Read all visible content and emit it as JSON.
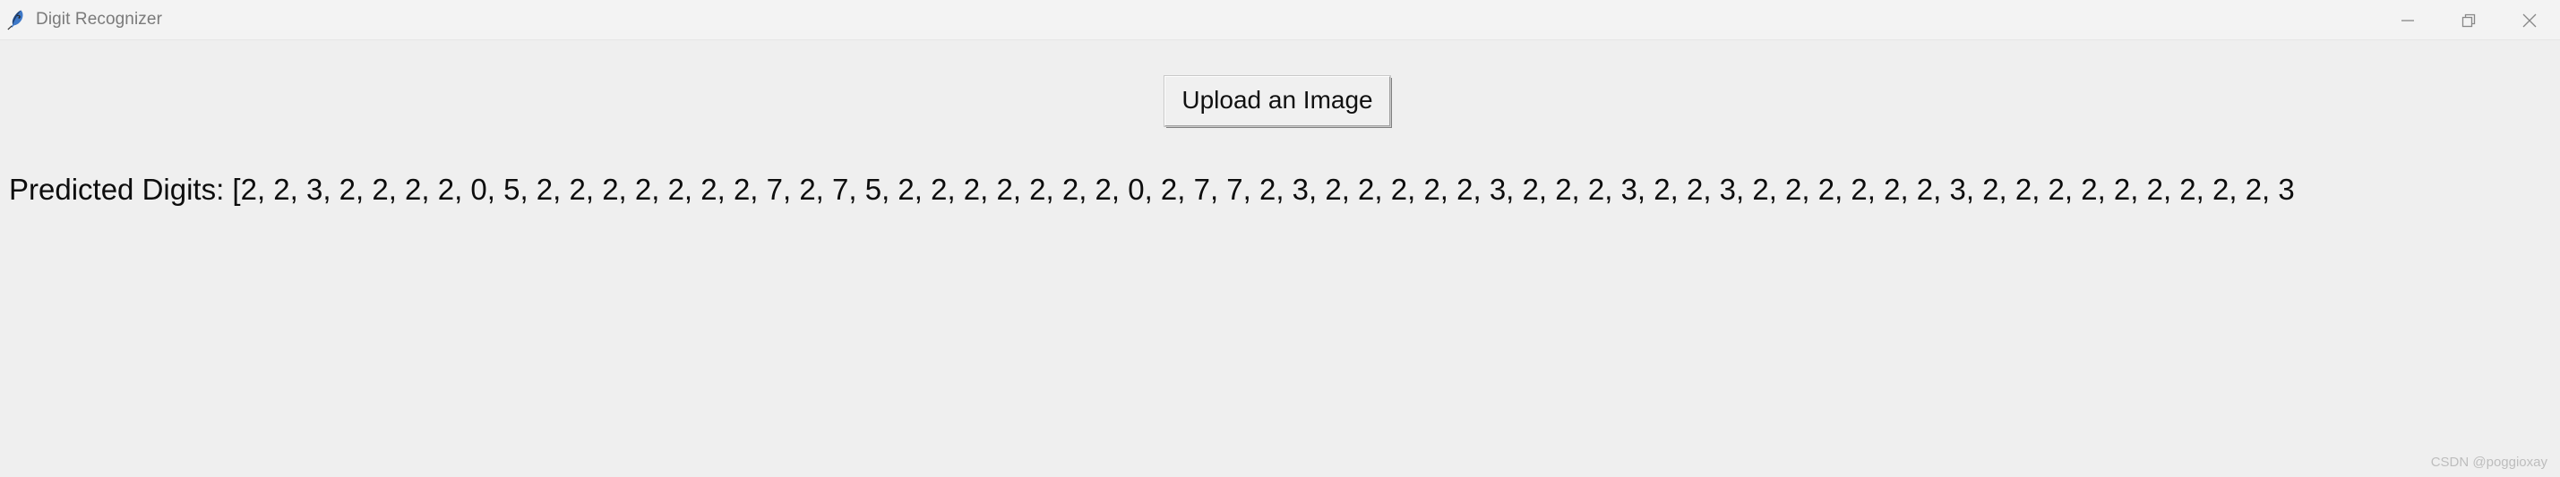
{
  "window": {
    "title": "Digit Recognizer",
    "icon": "tkinter-feather-icon",
    "controls": {
      "minimize": "minimize-icon",
      "restore": "restore-icon",
      "close": "close-icon"
    },
    "titlebar_color": "#f3f3f3",
    "body_color": "#efefef"
  },
  "main": {
    "upload_button_label": "Upload an Image",
    "prediction_label": "Predicted Digits: ",
    "prediction_open_bracket": "[",
    "prediction_text": "Predicted Digits: [2, 2, 3, 2, 2, 2, 2, 0, 5, 2, 2, 2, 2, 2, 2, 2, 7, 2, 7, 5, 2, 2, 2, 2, 2, 2, 2, 0, 2, 7, 7, 2, 3, 2, 2, 2, 2, 2, 3, 2, 2, 2, 3, 2, 2, 3, 2, 2, 2, 2, 2, 2, 3, 2, 2, 2, 2, 2, 2, 2, 2, 2, 3"
  },
  "predicted_digits": [
    2,
    2,
    3,
    2,
    2,
    2,
    2,
    0,
    5,
    2,
    2,
    2,
    2,
    2,
    2,
    2,
    7,
    2,
    7,
    5,
    2,
    2,
    2,
    2,
    2,
    2,
    2,
    0,
    2,
    7,
    7,
    2,
    3,
    2,
    2,
    2,
    2,
    2,
    3,
    2,
    2,
    2,
    3,
    2,
    2,
    3,
    2,
    2,
    2,
    2,
    2,
    2,
    3,
    2,
    2,
    2,
    2,
    2,
    2,
    2,
    2,
    2,
    3
  ],
  "watermark": {
    "text": "CSDN @poggioxay"
  }
}
